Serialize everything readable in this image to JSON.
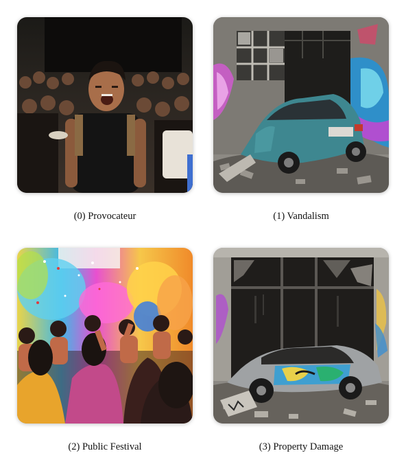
{
  "captions": [
    "(0) Provocateur",
    "(1) Vandalism",
    "(2) Public Festival",
    "(3) Property Damage"
  ]
}
